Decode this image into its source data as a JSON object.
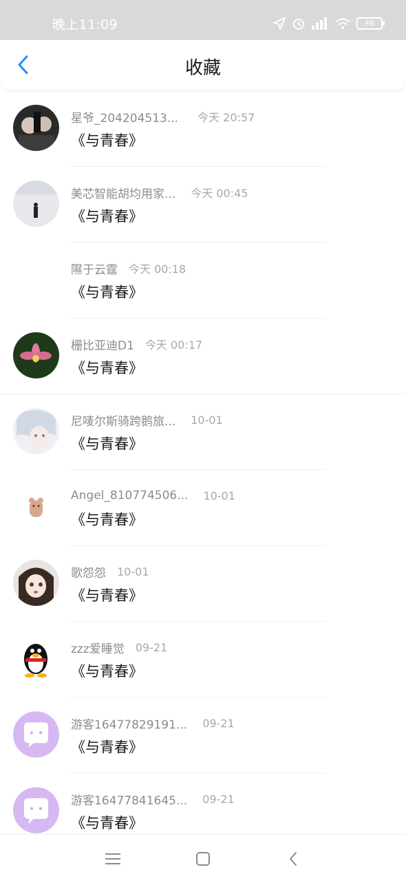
{
  "status": {
    "time": "晚上11:09",
    "battery": "46"
  },
  "header": {
    "title": "收藏"
  },
  "items": [
    {
      "name": "星爷_204204513...",
      "date": "今天 20:57",
      "book": "《与青春》"
    },
    {
      "name": "美芯智能胡均用家...",
      "date": "今天 00:45",
      "book": "《与青春》"
    },
    {
      "name": "隰于云霆",
      "date": "今天 00:18",
      "book": "《与青春》"
    },
    {
      "name": "栅比亚迪D1",
      "date": "今天 00:17",
      "book": "《与青春》"
    },
    {
      "name": "尼唛尔斯骑跨鹅旅...",
      "date": "10-01",
      "book": "《与青春》"
    },
    {
      "name": "Angel_810774506...",
      "date": "10-01",
      "book": "《与青春》"
    },
    {
      "name": "歌怨怨",
      "date": "10-01",
      "book": "《与青春》"
    },
    {
      "name": "zzz爱睡觉",
      "date": "09-21",
      "book": "《与青春》"
    },
    {
      "name": "游客16477829191...",
      "date": "09-21",
      "book": "《与青春》"
    },
    {
      "name": "游客16477841645...",
      "date": "09-21",
      "book": "《与青春》"
    }
  ],
  "icons": {
    "back": "chevron-left-icon",
    "nav_menu": "menu-icon",
    "nav_home": "home-square-icon",
    "nav_back": "back-icon"
  },
  "colors": {
    "accent": "#1e90ff",
    "avatar_purple": "#d6b8f3"
  }
}
